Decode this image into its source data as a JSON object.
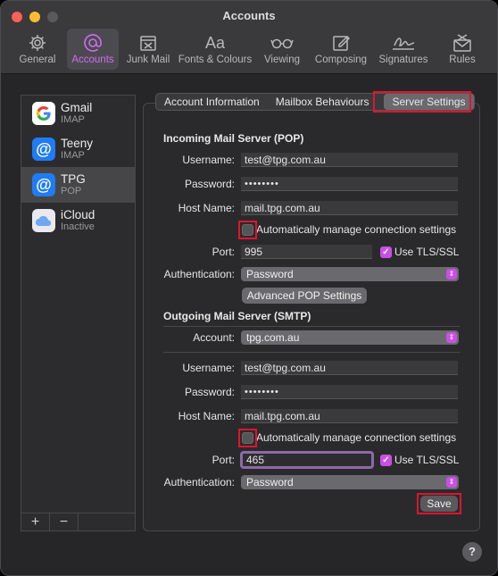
{
  "window": {
    "title": "Accounts"
  },
  "toolbar": {
    "items": [
      {
        "label": "General",
        "icon": "gear-icon"
      },
      {
        "label": "Accounts",
        "icon": "at-icon",
        "selected": true
      },
      {
        "label": "Junk Mail",
        "icon": "junk-icon"
      },
      {
        "label": "Fonts & Colours",
        "icon": "font-icon"
      },
      {
        "label": "Viewing",
        "icon": "glasses-icon"
      },
      {
        "label": "Composing",
        "icon": "compose-icon"
      },
      {
        "label": "Signatures",
        "icon": "signature-icon"
      },
      {
        "label": "Rules",
        "icon": "rules-icon"
      }
    ]
  },
  "sidebar": {
    "accounts": [
      {
        "name": "Gmail",
        "type": "IMAP",
        "icon": "google-icon"
      },
      {
        "name": "Teeny",
        "type": "IMAP",
        "icon": "at-icon"
      },
      {
        "name": "TPG",
        "type": "POP",
        "icon": "at-icon",
        "selected": true
      },
      {
        "name": "iCloud",
        "type": "Inactive",
        "icon": "icloud-icon"
      }
    ],
    "add_label": "+",
    "remove_label": "−"
  },
  "tabs": [
    {
      "label": "Account Information"
    },
    {
      "label": "Mailbox Behaviours"
    },
    {
      "label": "Server Settings",
      "selected": true
    }
  ],
  "incoming": {
    "title": "Incoming Mail Server (POP)",
    "username_label": "Username:",
    "username": "test@tpg.com.au",
    "password_label": "Password:",
    "password": "••••••••",
    "host_label": "Host Name:",
    "host": "mail.tpg.com.au",
    "auto_manage_label": "Automatically manage connection settings",
    "auto_manage": false,
    "port_label": "Port:",
    "port": "995",
    "tls_label": "Use TLS/SSL",
    "tls": true,
    "auth_label": "Authentication:",
    "auth": "Password",
    "advanced_button": "Advanced POP Settings"
  },
  "outgoing": {
    "title": "Outgoing Mail Server (SMTP)",
    "account_label": "Account:",
    "account": "tpg.com.au",
    "username_label": "Username:",
    "username": "test@tpg.com.au",
    "password_label": "Password:",
    "password": "••••••••",
    "host_label": "Host Name:",
    "host": "mail.tpg.com.au",
    "auto_manage_label": "Automatically manage connection settings",
    "auto_manage": false,
    "port_label": "Port:",
    "port": "465",
    "tls_label": "Use TLS/SSL",
    "tls": true,
    "auth_label": "Authentication:",
    "auth": "Password"
  },
  "footer": {
    "save_button": "Save",
    "help_label": "?"
  },
  "colors": {
    "accent": "#c94fe6",
    "highlight_box": "#e0142e",
    "selection_blue": "#1f7cf5"
  }
}
